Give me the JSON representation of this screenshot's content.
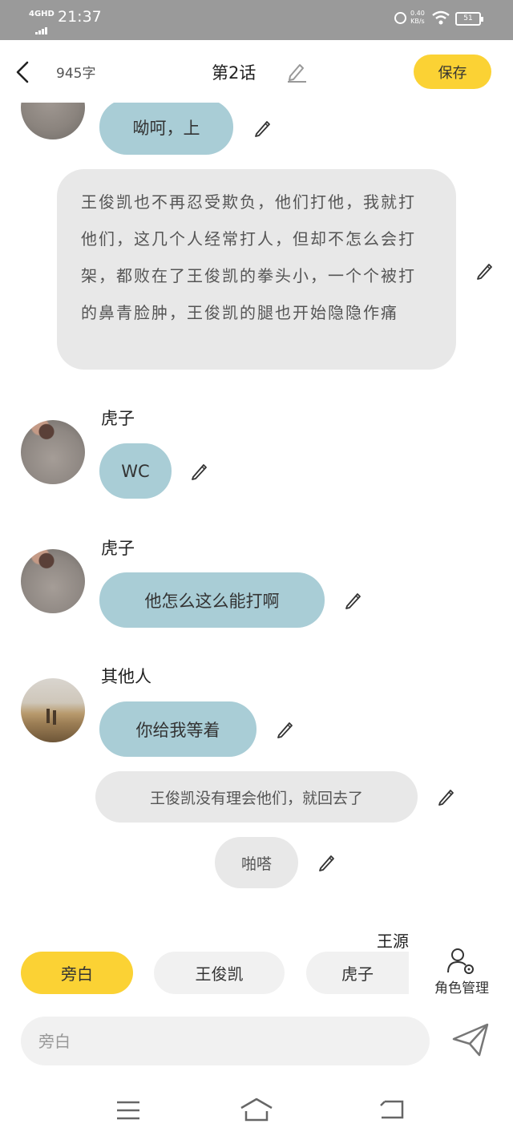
{
  "status_bar": {
    "network": "4GHD",
    "time": "21:37",
    "speed": "0.40",
    "speed_unit": "KB/s",
    "battery": "51"
  },
  "header": {
    "word_count": "945字",
    "title": "第2话",
    "save_label": "保存"
  },
  "messages": [
    {
      "type": "character",
      "text": "呦呵，上"
    },
    {
      "type": "narration",
      "text": "王俊凯也不再忍受欺负，他们打他，我就打他们，这几个人经常打人，但却不怎么会打架，都败在了王俊凯的拳头小，一个个被打的鼻青脸肿，王俊凯的腿也开始隐隐作痛"
    },
    {
      "type": "character",
      "name": "虎子",
      "text": "WC"
    },
    {
      "type": "character",
      "name": "虎子",
      "text": "他怎么这么能打啊"
    },
    {
      "type": "character",
      "name": "其他人",
      "text": "你给我等着"
    },
    {
      "type": "narration",
      "text": "王俊凯没有理会他们，就回去了"
    },
    {
      "type": "narration",
      "text": "啪嗒"
    }
  ],
  "roles": {
    "floating_name": "王源",
    "items": [
      "旁白",
      "王俊凯",
      "虎子"
    ],
    "active": "旁白",
    "manage_label": "角色管理"
  },
  "composer": {
    "placeholder": "旁白"
  },
  "colors": {
    "accent": "#fbd234",
    "bubble_character": "#a9cdd6",
    "bubble_narration": "#e8e8e8"
  },
  "icons": [
    "back-icon",
    "pencil-icon",
    "role-manage-icon",
    "send-icon",
    "menu-icon",
    "home-icon",
    "return-icon"
  ]
}
